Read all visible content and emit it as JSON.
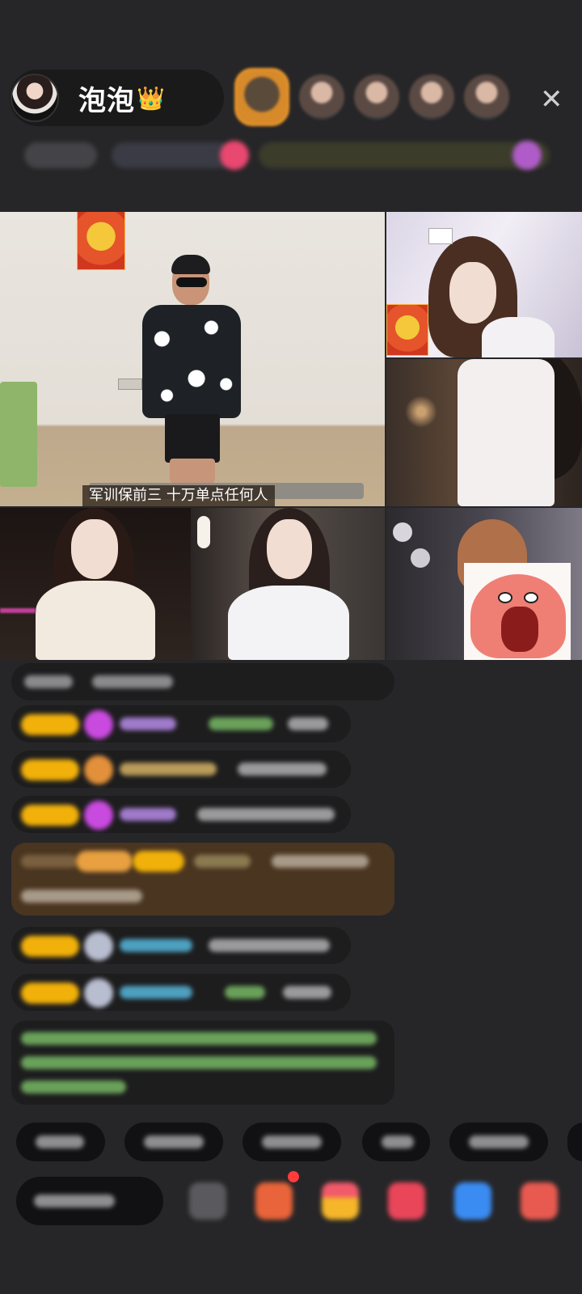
{
  "host": {
    "name": "泡泡",
    "crown_icon": "crown-icon"
  },
  "viewers": [
    "viewer-avatar",
    "viewer-avatar",
    "viewer-avatar",
    "viewer-avatar",
    "viewer-avatar"
  ],
  "close": "✕",
  "video": {
    "main_caption": "军训保前三  十万单点任何人"
  },
  "colors": {
    "background": "#262628",
    "badge_gold": "#f2b10a",
    "chat_bubble": "#1d1d1e",
    "system_text_green": "#7fcf5a",
    "gift_bubble_brown": "#4a3520"
  }
}
